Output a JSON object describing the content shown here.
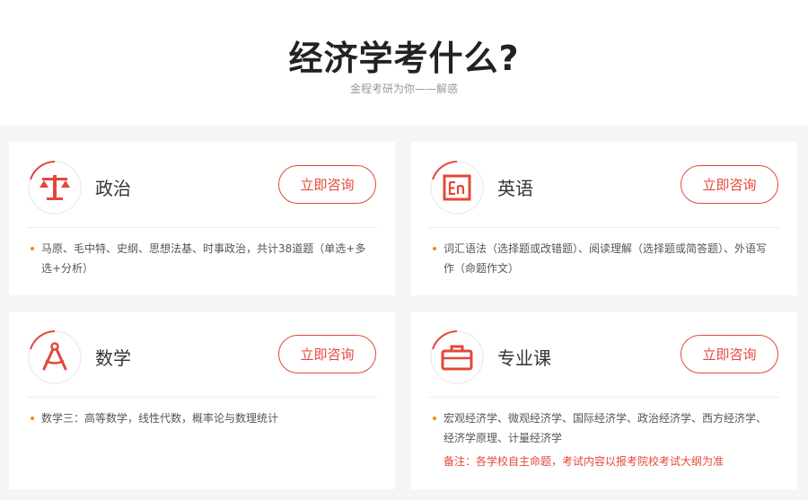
{
  "header": {
    "title": "经济学考什么?",
    "subtitle": "金程考研为你——解惑"
  },
  "colors": {
    "accent": "#e3483a",
    "bullet": "#f08a1c",
    "background": "#f4f5f7"
  },
  "cards": [
    {
      "name": "政治",
      "icon": "scales-icon",
      "button": "立即咨询",
      "description": "马原、毛中特、史纲、思想法基、时事政治，共计38道题（单选+多选+分析）"
    },
    {
      "name": "英语",
      "icon": "en-icon",
      "button": "立即咨询",
      "description": "词汇语法（选择题或改错题）、阅读理解（选择题或简答题）、外语写作（命题作文）"
    },
    {
      "name": "数学",
      "icon": "compass-icon",
      "button": "立即咨询",
      "description": "数学三：高等数学，线性代数，概率论与数理统计"
    },
    {
      "name": "专业课",
      "icon": "briefcase-icon",
      "button": "立即咨询",
      "description": "宏观经济学、微观经济学、国际经济学、政治经济学、西方经济学、经济学原理、计量经济学",
      "note": "备注：各学校自主命题，考试内容以报考院校考试大纲为准"
    }
  ]
}
